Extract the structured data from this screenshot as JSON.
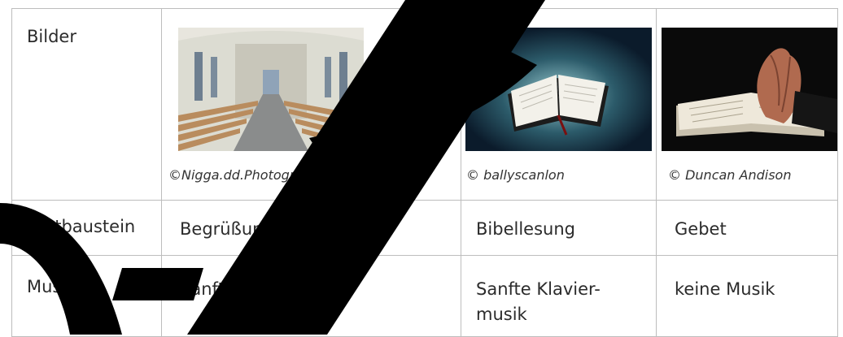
{
  "table": {
    "rows": {
      "bilder": {
        "label": "Bilder",
        "credits": [
          "©Nigga.dd.Photography Photography",
          "© ballyscanlon",
          "© Duncan Andison"
        ]
      },
      "textbaustein": {
        "label": "Textbaustein",
        "cells": [
          "Begrüßung",
          "Bibellesung",
          "Gebet"
        ]
      },
      "musik": {
        "label": "Musik",
        "cells": [
          "Sanfte Klaviermusik",
          "Sanfte Klavier-\nmusik",
          "keine Musik"
        ]
      }
    }
  },
  "images": [
    {
      "subject": "church-interior",
      "colors": {
        "wall": "#dcdcd2",
        "pews": "#b98c5e",
        "aisle": "#8a8c8c"
      }
    },
    {
      "subject": "open-bible-glow",
      "colors": {
        "background": "#0b1b2b",
        "glow": "#9fd1d6"
      }
    },
    {
      "subject": "praying-hands-on-book",
      "colors": {
        "background": "#0a0a0a",
        "paper": "#eee8da",
        "hands": "#b06a4f"
      }
    }
  ],
  "watermark": {
    "color": "#000000"
  }
}
